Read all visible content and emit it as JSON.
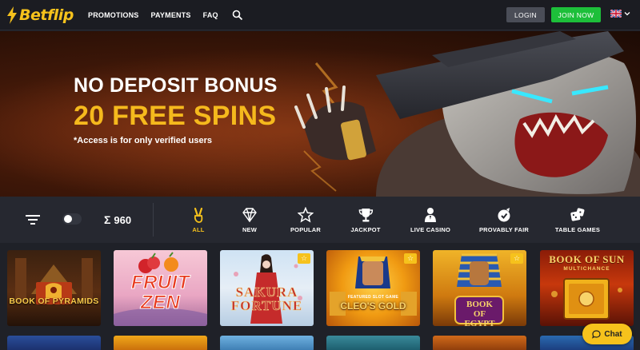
{
  "brand": {
    "name": "Betflip",
    "color": "#f6c21c"
  },
  "nav": {
    "items": [
      {
        "label": "PROMOTIONS"
      },
      {
        "label": "PAYMENTS"
      },
      {
        "label": "FAQ"
      }
    ],
    "search_icon": "search-icon"
  },
  "auth": {
    "login_label": "LOGIN",
    "join_label": "JOIN NOW"
  },
  "language": {
    "flag": "uk-flag-icon"
  },
  "hero": {
    "title": "NO DEPOSIT BONUS",
    "subtitle": "20 FREE SPINS",
    "note": "*Access is for only verified users"
  },
  "filters": {
    "count": "960",
    "categories": [
      {
        "label": "ALL",
        "icon": "victory-hand-icon",
        "active": true
      },
      {
        "label": "NEW",
        "icon": "diamond-icon"
      },
      {
        "label": "POPULAR",
        "icon": "star-icon"
      },
      {
        "label": "JACKPOT",
        "icon": "trophy-icon"
      },
      {
        "label": "LIVE CASINO",
        "icon": "dealer-icon"
      },
      {
        "label": "PROVABLY FAIR",
        "icon": "shield-icon"
      },
      {
        "label": "TABLE GAMES",
        "icon": "dice-icon"
      }
    ]
  },
  "games": [
    {
      "title": "BOOK OF PYRAMIDS"
    },
    {
      "title": "FRUIT ZEN"
    },
    {
      "title": "SAKURA FORTUNE"
    },
    {
      "title": "CLEO'S GOLD",
      "tag": "FEATURED SLOT GAME"
    },
    {
      "title": "BOOK OF EGYPT"
    },
    {
      "title": "BOOK OF SUN",
      "subtitle": "MULTICHANCE"
    }
  ],
  "chat": {
    "label": "Chat"
  }
}
